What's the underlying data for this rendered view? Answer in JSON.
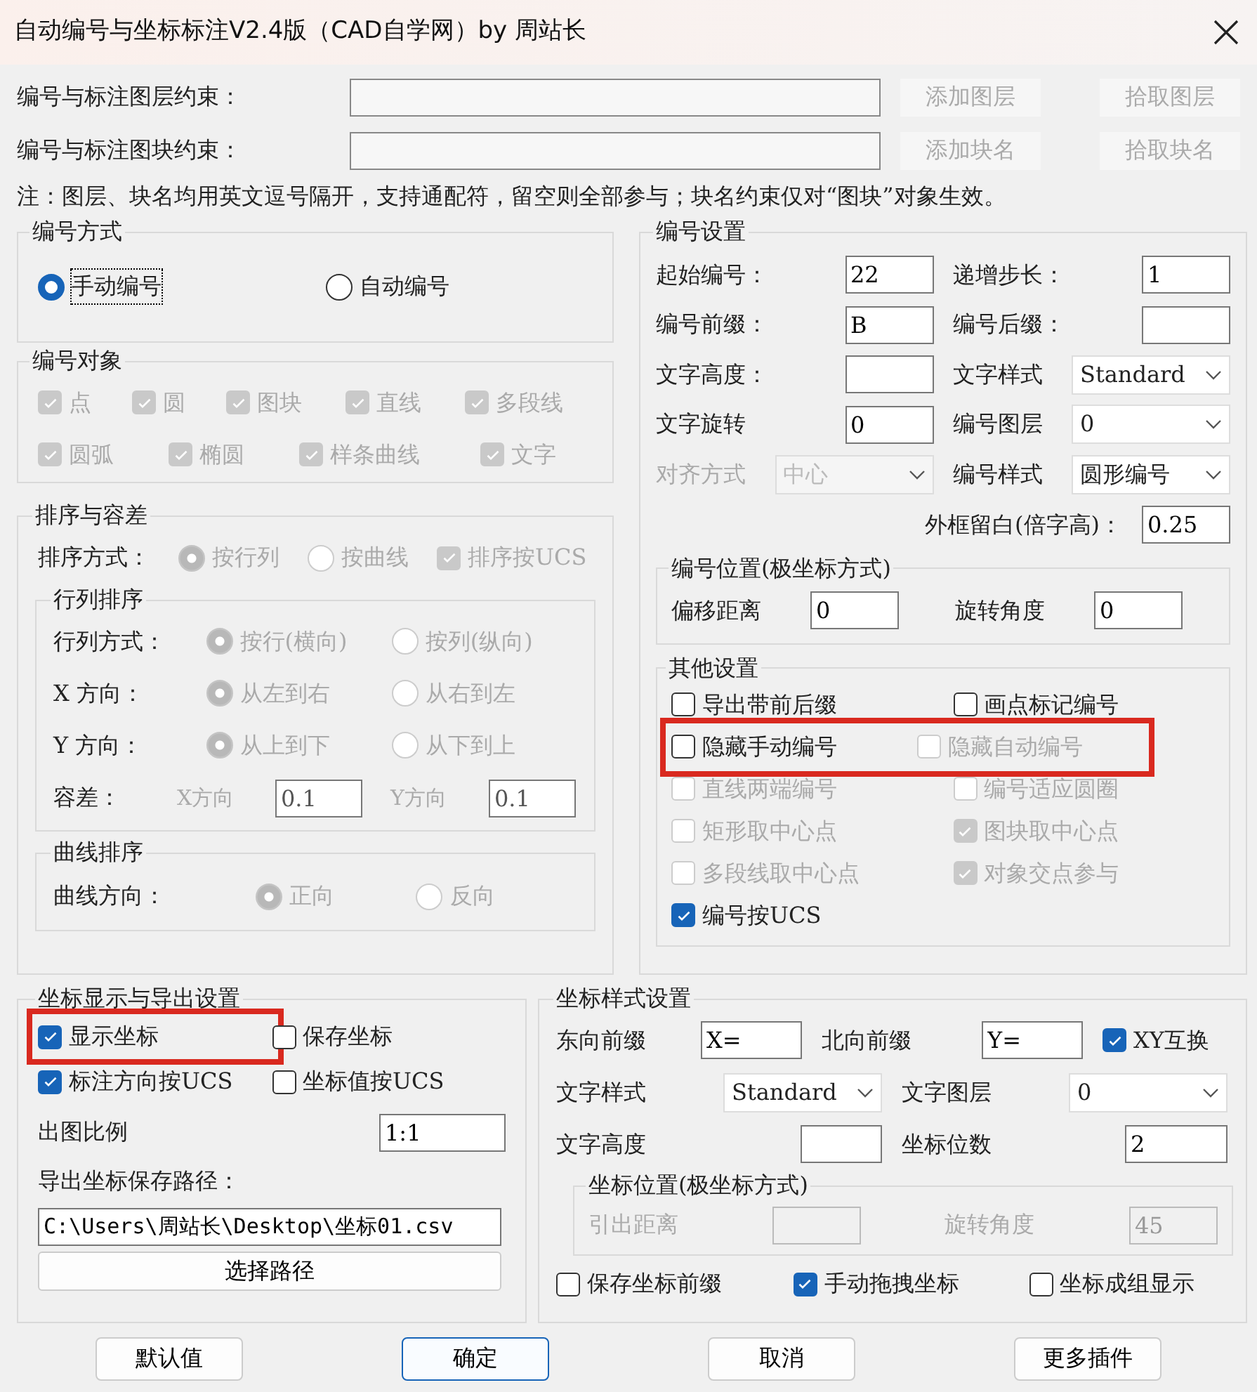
{
  "window": {
    "title": "自动编号与坐标标注V2.4版（CAD自学网）by 周站长"
  },
  "constraints": [
    {
      "label": "编号与标注图层约束：",
      "buttons": [
        {
          "label": "添加图层",
          "disabled": true
        },
        {
          "label": "拾取图层",
          "disabled": true
        }
      ]
    },
    {
      "label": "编号与标注图块约束：",
      "buttons": [
        {
          "label": "添加块名",
          "disabled": true
        },
        {
          "label": "拾取块名",
          "disabled": true
        }
      ]
    }
  ],
  "note": "注：图层、块名均用英文逗号隔开，支持通配符，留空则全部参与；块名约束仅对“图块”对象生效。",
  "numbering_mode": {
    "title": "编号方式",
    "options": [
      {
        "label": "手动编号",
        "selected": true,
        "focused": true
      },
      {
        "label": "自动编号",
        "selected": false,
        "focused": false
      }
    ]
  },
  "objects": {
    "title": "编号对象",
    "items": [
      {
        "label": "点",
        "checked": true,
        "disabled": true
      },
      {
        "label": "圆",
        "checked": true,
        "disabled": true
      },
      {
        "label": "图块",
        "checked": true,
        "disabled": true
      },
      {
        "label": "直线",
        "checked": true,
        "disabled": true
      },
      {
        "label": "多段线",
        "checked": true,
        "disabled": true
      },
      {
        "label": "圆弧",
        "checked": true,
        "disabled": true
      },
      {
        "label": "椭圆",
        "checked": true,
        "disabled": true
      },
      {
        "label": "样条曲线",
        "checked": true,
        "disabled": true
      },
      {
        "label": "文字",
        "checked": true,
        "disabled": true
      }
    ]
  },
  "sorting": {
    "title": "排序与容差",
    "method_label": "排序方式：",
    "methods": [
      {
        "label": "按行列",
        "selected": true,
        "disabled": true
      },
      {
        "label": "按曲线",
        "selected": false,
        "disabled": true
      }
    ],
    "ucs": {
      "label": "排序按UCS",
      "checked": true,
      "disabled": true
    },
    "grid": {
      "title": "行列排序",
      "rows": [
        {
          "label": "行列方式：",
          "options": [
            {
              "label": "按行(横向)",
              "selected": true,
              "disabled": true
            },
            {
              "label": "按列(纵向)",
              "selected": false,
              "disabled": true
            }
          ]
        },
        {
          "label": "X 方向：",
          "options": [
            {
              "label": "从左到右",
              "selected": true,
              "disabled": true
            },
            {
              "label": "从右到左",
              "selected": false,
              "disabled": true
            }
          ]
        },
        {
          "label": "Y 方向：",
          "options": [
            {
              "label": "从上到下",
              "selected": true,
              "disabled": true
            },
            {
              "label": "从下到上",
              "selected": false,
              "disabled": true
            }
          ]
        }
      ],
      "tolerance": {
        "label": "容差：",
        "fields": [
          {
            "label": "X方向",
            "value": "0.1"
          },
          {
            "label": "Y方向",
            "value": "0.1"
          }
        ]
      }
    },
    "curve": {
      "title": "曲线排序",
      "label": "曲线方向：",
      "options": [
        {
          "label": "正向",
          "selected": true,
          "disabled": true
        },
        {
          "label": "反向",
          "selected": false,
          "disabled": true
        }
      ]
    }
  },
  "numbering_settings": {
    "title": "编号设置",
    "rows": [
      [
        {
          "label": "起始编号：",
          "kind": "input",
          "value": "22"
        },
        {
          "label": "递增步长：",
          "kind": "input",
          "value": "1"
        }
      ],
      [
        {
          "label": "编号前缀：",
          "kind": "input",
          "value": "B"
        },
        {
          "label": "编号后缀：",
          "kind": "input"
        }
      ],
      [
        {
          "label": "文字高度：",
          "kind": "input"
        },
        {
          "label": "文字样式",
          "kind": "select",
          "value": "Standard"
        }
      ],
      [
        {
          "label": "文字旋转",
          "kind": "input",
          "value": "0"
        },
        {
          "label": "编号图层",
          "kind": "select",
          "value": "0"
        }
      ],
      [
        {
          "label": "对齐方式",
          "kind": "select",
          "value": "中心",
          "disabled": true
        },
        {
          "label": "编号样式",
          "kind": "select",
          "value": "圆形编号"
        }
      ]
    ],
    "margin": {
      "label": "外框留白(倍字高)：",
      "kind": "input",
      "value": "0.25"
    },
    "position": {
      "title": "编号位置(极坐标方式)",
      "fields": [
        {
          "label": "偏移距离",
          "kind": "input",
          "value": "0"
        },
        {
          "label": "旋转角度",
          "kind": "input",
          "value": "0"
        }
      ]
    },
    "other": {
      "title": "其他设置",
      "rows": [
        {
          "highlighted": false,
          "items": [
            {
              "label": "导出带前后缀",
              "checked": false,
              "disabled": false
            },
            {
              "label": "画点标记编号",
              "checked": false,
              "disabled": false
            }
          ]
        },
        {
          "highlighted": true,
          "items": [
            {
              "label": "隐藏手动编号",
              "checked": false,
              "disabled": false
            },
            {
              "label": "隐藏自动编号",
              "checked": false,
              "disabled": true
            }
          ]
        },
        {
          "highlighted": false,
          "items": [
            {
              "label": "直线两端编号",
              "checked": false,
              "disabled": true
            },
            {
              "label": "编号适应圆圈",
              "checked": false,
              "disabled": true
            }
          ]
        },
        {
          "highlighted": false,
          "items": [
            {
              "label": "矩形取中心点",
              "checked": false,
              "disabled": true
            },
            {
              "label": "图块取中心点",
              "checked": true,
              "disabled": true
            }
          ]
        },
        {
          "highlighted": false,
          "items": [
            {
              "label": "多段线取中心点",
              "checked": false,
              "disabled": true
            },
            {
              "label": "对象交点参与",
              "checked": true,
              "disabled": true
            }
          ]
        },
        {
          "highlighted": false,
          "items": [
            {
              "label": "编号按UCS",
              "checked": true,
              "disabled": false
            }
          ]
        }
      ]
    }
  },
  "coord_output": {
    "title": "坐标显示与导出设置",
    "rows": [
      {
        "items": [
          {
            "label": "显示坐标",
            "checked": true,
            "highlighted": true
          },
          {
            "label": "保存坐标",
            "checked": false,
            "highlighted": false
          }
        ]
      },
      {
        "items": [
          {
            "label": "标注方向按UCS",
            "checked": true,
            "highlighted": false
          },
          {
            "label": "坐标值按UCS",
            "checked": false,
            "highlighted": false
          }
        ]
      }
    ],
    "scale": {
      "label": "出图比例",
      "value": "1:1"
    },
    "path": {
      "label": "导出坐标保存路径：",
      "value": "C:\\Users\\周站长\\Desktop\\坐标01.csv"
    },
    "choose_button": "选择路径"
  },
  "coord_style": {
    "title": "坐标样式设置",
    "rows": [
      [
        {
          "label": "东向前缀",
          "kind": "input",
          "value": "X="
        },
        {
          "label": "北向前缀",
          "kind": "input",
          "value": "Y="
        },
        {
          "label": "XY互换",
          "kind": "check",
          "checked": true
        }
      ],
      [
        {
          "label": "文字样式",
          "kind": "select",
          "value": "Standard"
        },
        {
          "label": "文字图层",
          "kind": "select",
          "value": "0"
        }
      ],
      [
        {
          "label": "文字高度",
          "kind": "input"
        },
        {
          "label": "坐标位数",
          "kind": "input",
          "value": "2"
        }
      ]
    ],
    "position": {
      "title": "坐标位置(极坐标方式)",
      "disabled": true,
      "fields": [
        {
          "label": "引出距离",
          "kind": "input"
        },
        {
          "label": "旋转角度",
          "kind": "input",
          "value": "45"
        }
      ]
    },
    "checks": [
      {
        "label": "保存坐标前缀",
        "checked": false
      },
      {
        "label": "手动拖拽坐标",
        "checked": true
      },
      {
        "label": "坐标成组显示",
        "checked": false
      }
    ]
  },
  "buttons": [
    {
      "label": "默认值",
      "default": false
    },
    {
      "label": "确定",
      "default": true
    },
    {
      "label": "取消",
      "default": false
    },
    {
      "label": "更多插件",
      "default": false
    }
  ]
}
